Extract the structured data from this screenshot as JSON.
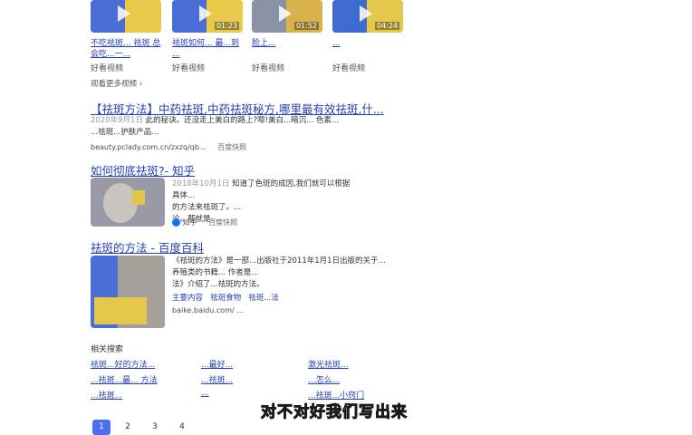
{
  "videos": [
    {
      "title": "不吃祛斑... 祛斑 总会吃...一...",
      "source": "好看视频",
      "duration": ""
    },
    {
      "title": "祛斑如何... 最...到 ...",
      "source": "好看视频",
      "duration": "01:23"
    },
    {
      "title": "脸上...",
      "source": "好看视频",
      "duration": "01:52"
    },
    {
      "title": "...",
      "source": "好看视频",
      "duration": "04:24"
    }
  ],
  "more_videos": "观看更多视频 ›",
  "results": [
    {
      "title": "【祛斑方法】中药祛斑,中药祛斑秘方,哪里最有效祛斑,什...",
      "date": "2020年9月1日",
      "snippet_1": "此的秘诀。还没走上美白的路上?嗯!美白...暗沉... 色素...",
      "snippet_2": "...祛斑...护肤产品...",
      "url": "beauty.pclady.com.cn/zxzq/qb...",
      "cache": "百度快照"
    },
    {
      "title": "如何彻底祛斑?- 知乎",
      "date": "2018年10月1日",
      "snippet_1": "知道了色斑的成因,我们就可以根据具体...",
      "snippet_2": "的方法来祛斑了。...",
      "snippet_3": "论。那就是...",
      "url": "知乎",
      "cache": "百度快照"
    },
    {
      "title": "祛斑的方法 - 百度百科",
      "snippet_1": "《祛斑的方法》是一部...出版社于2011年1月1日出版的关于...",
      "snippet_2": "养殖类的书籍... 作者是...",
      "snippet_3": "法》介绍了...祛斑的方法。",
      "subs": [
        "主要内容",
        "祛斑食物",
        "祛斑...法"
      ],
      "url": "baike.baidu.com/ ..."
    }
  ],
  "related": {
    "heading": "相关搜索",
    "items": [
      "祛斑...好的方法...",
      "...最好...",
      "激光祛斑...",
      "...祛斑...最... 方法",
      "...祛斑...",
      "...怎么...",
      "...祛斑...",
      "...",
      "...祛斑...小窍门"
    ]
  },
  "caption": "对不对好我们写出来",
  "pagination": [
    "1",
    "2",
    "3",
    "4"
  ]
}
